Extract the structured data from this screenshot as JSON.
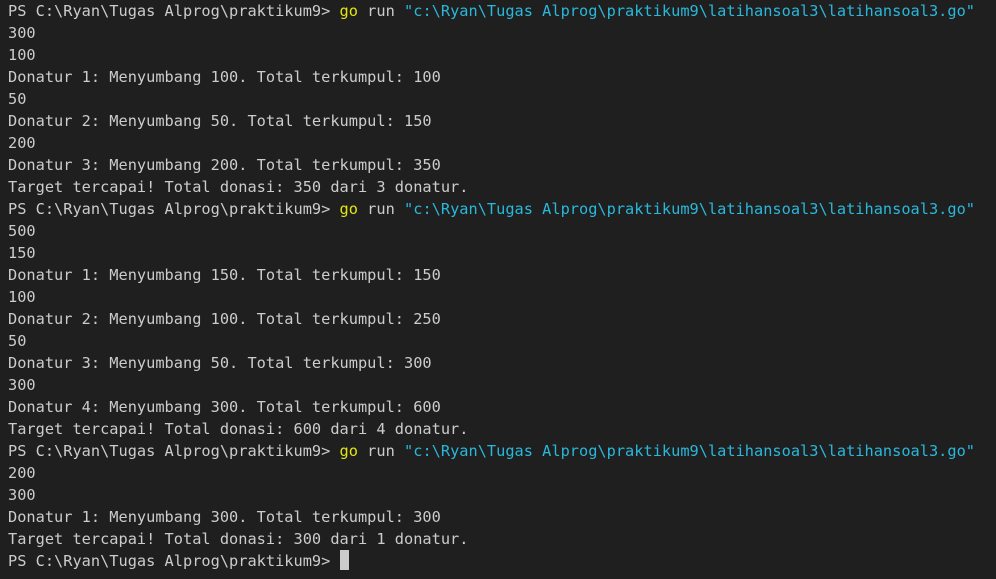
{
  "terminal": {
    "lines": [
      {
        "type": "command",
        "prompt": "PS C:\\Ryan\\Tugas Alprog\\praktikum9> ",
        "exe": "go",
        "arg": " run ",
        "path": "\"c:\\Ryan\\Tugas Alprog\\praktikum9\\latihansoal3\\latihansoal3.go\""
      },
      {
        "type": "output",
        "text": "300"
      },
      {
        "type": "output",
        "text": "100"
      },
      {
        "type": "output",
        "text": "Donatur 1: Menyumbang 100. Total terkumpul: 100"
      },
      {
        "type": "output",
        "text": "50"
      },
      {
        "type": "output",
        "text": "Donatur 2: Menyumbang 50. Total terkumpul: 150"
      },
      {
        "type": "output",
        "text": "200"
      },
      {
        "type": "output",
        "text": "Donatur 3: Menyumbang 200. Total terkumpul: 350"
      },
      {
        "type": "output",
        "text": "Target tercapai! Total donasi: 350 dari 3 donatur."
      },
      {
        "type": "command",
        "prompt": "PS C:\\Ryan\\Tugas Alprog\\praktikum9> ",
        "exe": "go",
        "arg": " run ",
        "path": "\"c:\\Ryan\\Tugas Alprog\\praktikum9\\latihansoal3\\latihansoal3.go\""
      },
      {
        "type": "output",
        "text": "500"
      },
      {
        "type": "output",
        "text": "150"
      },
      {
        "type": "output",
        "text": "Donatur 1: Menyumbang 150. Total terkumpul: 150"
      },
      {
        "type": "output",
        "text": "100"
      },
      {
        "type": "output",
        "text": "Donatur 2: Menyumbang 100. Total terkumpul: 250"
      },
      {
        "type": "output",
        "text": "50"
      },
      {
        "type": "output",
        "text": "Donatur 3: Menyumbang 50. Total terkumpul: 300"
      },
      {
        "type": "output",
        "text": "300"
      },
      {
        "type": "output",
        "text": "Donatur 4: Menyumbang 300. Total terkumpul: 600"
      },
      {
        "type": "output",
        "text": "Target tercapai! Total donasi: 600 dari 4 donatur."
      },
      {
        "type": "command",
        "prompt": "PS C:\\Ryan\\Tugas Alprog\\praktikum9> ",
        "exe": "go",
        "arg": " run ",
        "path": "\"c:\\Ryan\\Tugas Alprog\\praktikum9\\latihansoal3\\latihansoal3.go\""
      },
      {
        "type": "output",
        "text": "200"
      },
      {
        "type": "output",
        "text": "300"
      },
      {
        "type": "output",
        "text": "Donatur 1: Menyumbang 300. Total terkumpul: 300"
      },
      {
        "type": "output",
        "text": "Target tercapai! Total donasi: 300 dari 1 donatur."
      },
      {
        "type": "prompt",
        "prompt": "PS C:\\Ryan\\Tugas Alprog\\praktikum9> "
      }
    ]
  },
  "colors": {
    "background": "#1f1f1f",
    "text": "#cccccc",
    "exe": "#e5e510",
    "path": "#29b8db"
  }
}
